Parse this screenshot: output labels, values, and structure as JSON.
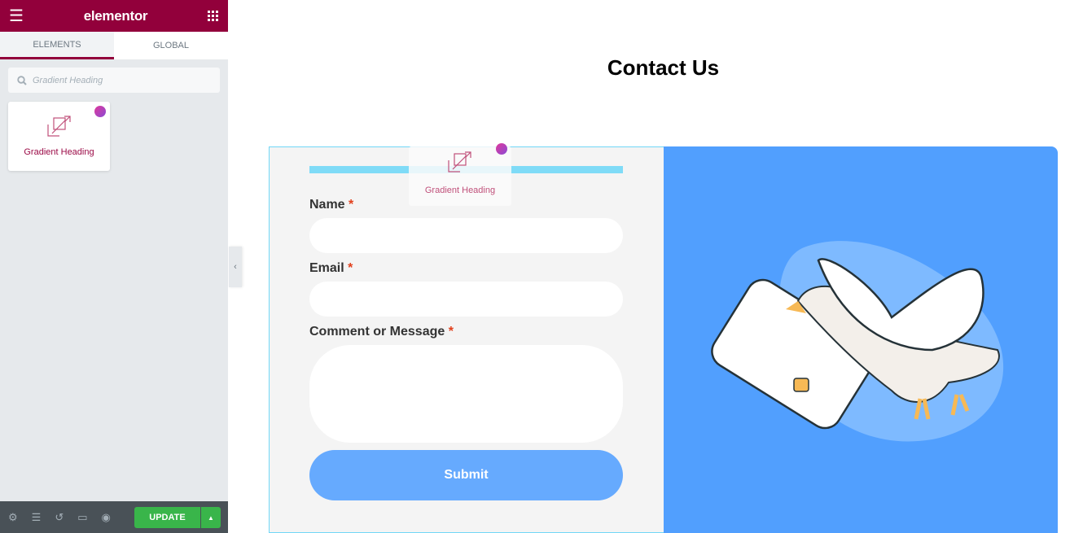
{
  "sidebar": {
    "logo": "elementor",
    "tabs": [
      {
        "label": "ELEMENTS",
        "active": true
      },
      {
        "label": "GLOBAL",
        "active": false
      }
    ],
    "search": {
      "value": "Gradient Heading"
    },
    "widgets": [
      {
        "label": "Gradient Heading",
        "icon": "gradient-heading-icon"
      }
    ],
    "footer": {
      "update_label": "UPDATE",
      "icons": [
        "settings-icon",
        "layers-icon",
        "history-icon",
        "responsive-icon",
        "preview-icon"
      ]
    }
  },
  "canvas": {
    "title": "Contact Us",
    "drag_ghost": {
      "label": "Gradient Heading"
    },
    "form": {
      "fields": [
        {
          "label": "Name",
          "required": "*"
        },
        {
          "label": "Email",
          "required": "*"
        },
        {
          "label": "Comment or Message",
          "required": "*"
        }
      ],
      "submit_label": "Submit"
    }
  },
  "colors": {
    "brand": "#92003b",
    "update": "#39b54a",
    "submit": "#66aafe",
    "image_bg": "#519ffe"
  }
}
